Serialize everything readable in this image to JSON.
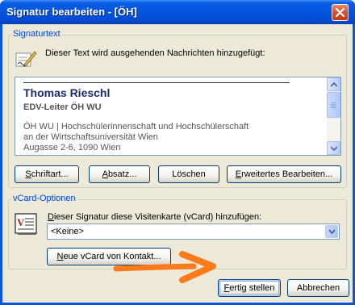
{
  "window": {
    "title": "Signatur bearbeiten - [ÖH]"
  },
  "signature_group": {
    "legend": "Signaturtext",
    "description": "Dieser Text wird ausgehenden Nachrichten hinzugefügt:",
    "editor": {
      "name": "Thomas Rieschl",
      "role": "EDV-Leiter ÖH WU",
      "lines": [
        "ÖH WU | Hochschülerinnenschaft und Hochschülerschaft",
        "an der Wirtschaftsuniversität Wien",
        "Augasse 2-6, 1090 Wien"
      ]
    },
    "buttons": {
      "font": {
        "label": "chriftart...",
        "accel": "S"
      },
      "paragraph": {
        "label": "bsatz...",
        "accel": "A"
      },
      "delete": {
        "label": "Löschen"
      },
      "advanced": {
        "label": "rweitertes Bearbeiten...",
        "accel": "E"
      }
    }
  },
  "vcard_group": {
    "legend": "vCard-Optionen",
    "label_accel": "D",
    "label": "ieser Signatur diese Visitenkarte (vCard) hinzufügen:",
    "select_value": "<Keine>",
    "new_vcard_button": {
      "accel": "N",
      "label": "eue vCard von Kontakt..."
    }
  },
  "footer": {
    "finish_button": {
      "accel": "F",
      "label": "ertig stellen"
    },
    "cancel_button": {
      "label": "Abbrechen"
    }
  },
  "colors": {
    "title_bar": "#0453dd",
    "dialog_bg": "#ece9d8",
    "legend": "#0046d5",
    "annotation_arrow": "#ff7a1a"
  },
  "icons": [
    "close-icon",
    "signature-pen-icon",
    "vcard-icon",
    "scroll-up-icon",
    "scroll-down-icon",
    "dropdown-arrow-icon"
  ]
}
